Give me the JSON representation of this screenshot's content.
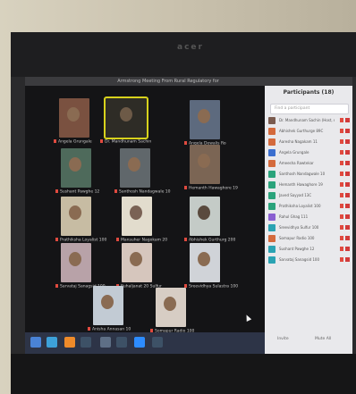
{
  "brand": "acer",
  "meeting": {
    "title": "Armstrong Meeting From Rural Regulatory for"
  },
  "gallery": {
    "tiles": [
      {
        "label": "Angela Grungale",
        "active": false
      },
      {
        "label": "Dr. Mandhunam Sachin",
        "active": true
      },
      {
        "label": "Angela Dewalis Ro",
        "active": false
      },
      {
        "label": "Sushant Pawghe 12",
        "active": false
      },
      {
        "label": "Santhosh Nandagwale 10",
        "active": false
      },
      {
        "label": "Hemanth Hawaghore 19",
        "active": false
      },
      {
        "label": "Prathiksha Loyalist 100",
        "active": false
      },
      {
        "label": "Mansuher Nagokam 20",
        "active": false
      },
      {
        "label": "Abhishek Gurthurg 200",
        "active": false
      },
      {
        "label": "Sarvataj Sanagsid 100",
        "active": false
      },
      {
        "label": "Ruhaljanat 20 Sulfur",
        "active": false
      },
      {
        "label": "Sreevidhya Sulastra 100",
        "active": false
      },
      {
        "label": "Anisha Annasan 10",
        "active": false
      },
      {
        "label": "Somapur Radio 100",
        "active": false
      }
    ]
  },
  "participants": {
    "header": "Participants (18)",
    "search_placeholder": "Find a participant",
    "items": [
      {
        "name": "Dr. Mandhunam Sachin (Host, me)"
      },
      {
        "name": "Abhishek Gurthurge 89C"
      },
      {
        "name": "Aaresha Nagakam 11"
      },
      {
        "name": "Angela Grungale"
      },
      {
        "name": "Ameesha Rawtekar"
      },
      {
        "name": "Santhosh Nandagwale 10"
      },
      {
        "name": "Hemanth Hawaghore 19"
      },
      {
        "name": "Javed Sayyad 13C"
      },
      {
        "name": "Prathiksha Loyalist 100"
      },
      {
        "name": "Rahul Ghag 111"
      },
      {
        "name": "Sreevidhya Sulfur 100"
      },
      {
        "name": "Somapur Radio 100"
      },
      {
        "name": "Sushant Pawghe 12"
      },
      {
        "name": "Sarvataj Sanagsid 100"
      }
    ],
    "footer_left": "Invite",
    "footer_right": "Mute All"
  },
  "colors": {
    "active_border": "#d8d21c",
    "muted": "#e04a3f",
    "panel_bg": "#e9e9ec"
  }
}
